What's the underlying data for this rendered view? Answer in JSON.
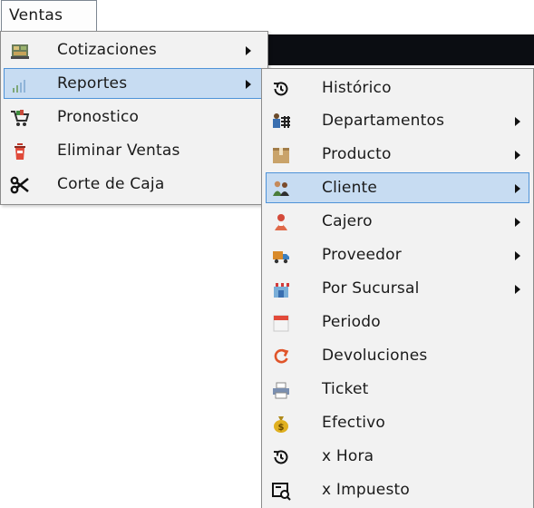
{
  "menubar": {
    "ventas_label": "Ventas"
  },
  "main_menu": {
    "items": [
      {
        "label": "Cotizaciones",
        "icon": "quotes-icon",
        "has_submenu": true
      },
      {
        "label": "Reportes",
        "icon": "chart-icon",
        "has_submenu": true,
        "selected": true
      },
      {
        "label": "Pronostico",
        "icon": "cart-icon",
        "has_submenu": false
      },
      {
        "label": "Eliminar Ventas",
        "icon": "delete-sales-icon",
        "has_submenu": false
      },
      {
        "label": "Corte de Caja",
        "icon": "scissors-icon",
        "has_submenu": false
      }
    ]
  },
  "reportes_menu": {
    "items": [
      {
        "label": "Histórico",
        "icon": "history-icon",
        "has_submenu": false
      },
      {
        "label": "Departamentos",
        "icon": "departments-icon",
        "has_submenu": true
      },
      {
        "label": "Producto",
        "icon": "product-box-icon",
        "has_submenu": true
      },
      {
        "label": "Cliente",
        "icon": "clients-icon",
        "has_submenu": true,
        "selected": true
      },
      {
        "label": "Cajero",
        "icon": "cashier-icon",
        "has_submenu": true
      },
      {
        "label": "Proveedor",
        "icon": "supplier-truck-icon",
        "has_submenu": true
      },
      {
        "label": "Por Sucursal",
        "icon": "store-icon",
        "has_submenu": true
      },
      {
        "label": "Periodo",
        "icon": "calendar-icon",
        "has_submenu": false
      },
      {
        "label": "Devoluciones",
        "icon": "return-arrow-icon",
        "has_submenu": false
      },
      {
        "label": "Ticket",
        "icon": "printer-icon",
        "has_submenu": false
      },
      {
        "label": "Efectivo",
        "icon": "money-bag-icon",
        "has_submenu": false
      },
      {
        "label": "x Hora",
        "icon": "history-icon",
        "has_submenu": false
      },
      {
        "label": "x Impuesto",
        "icon": "tax-icon",
        "has_submenu": false
      }
    ]
  },
  "colors": {
    "selection_bg": "#c7dcf2",
    "selection_border": "#4f93d8",
    "menu_bg": "#f2f2f2"
  }
}
